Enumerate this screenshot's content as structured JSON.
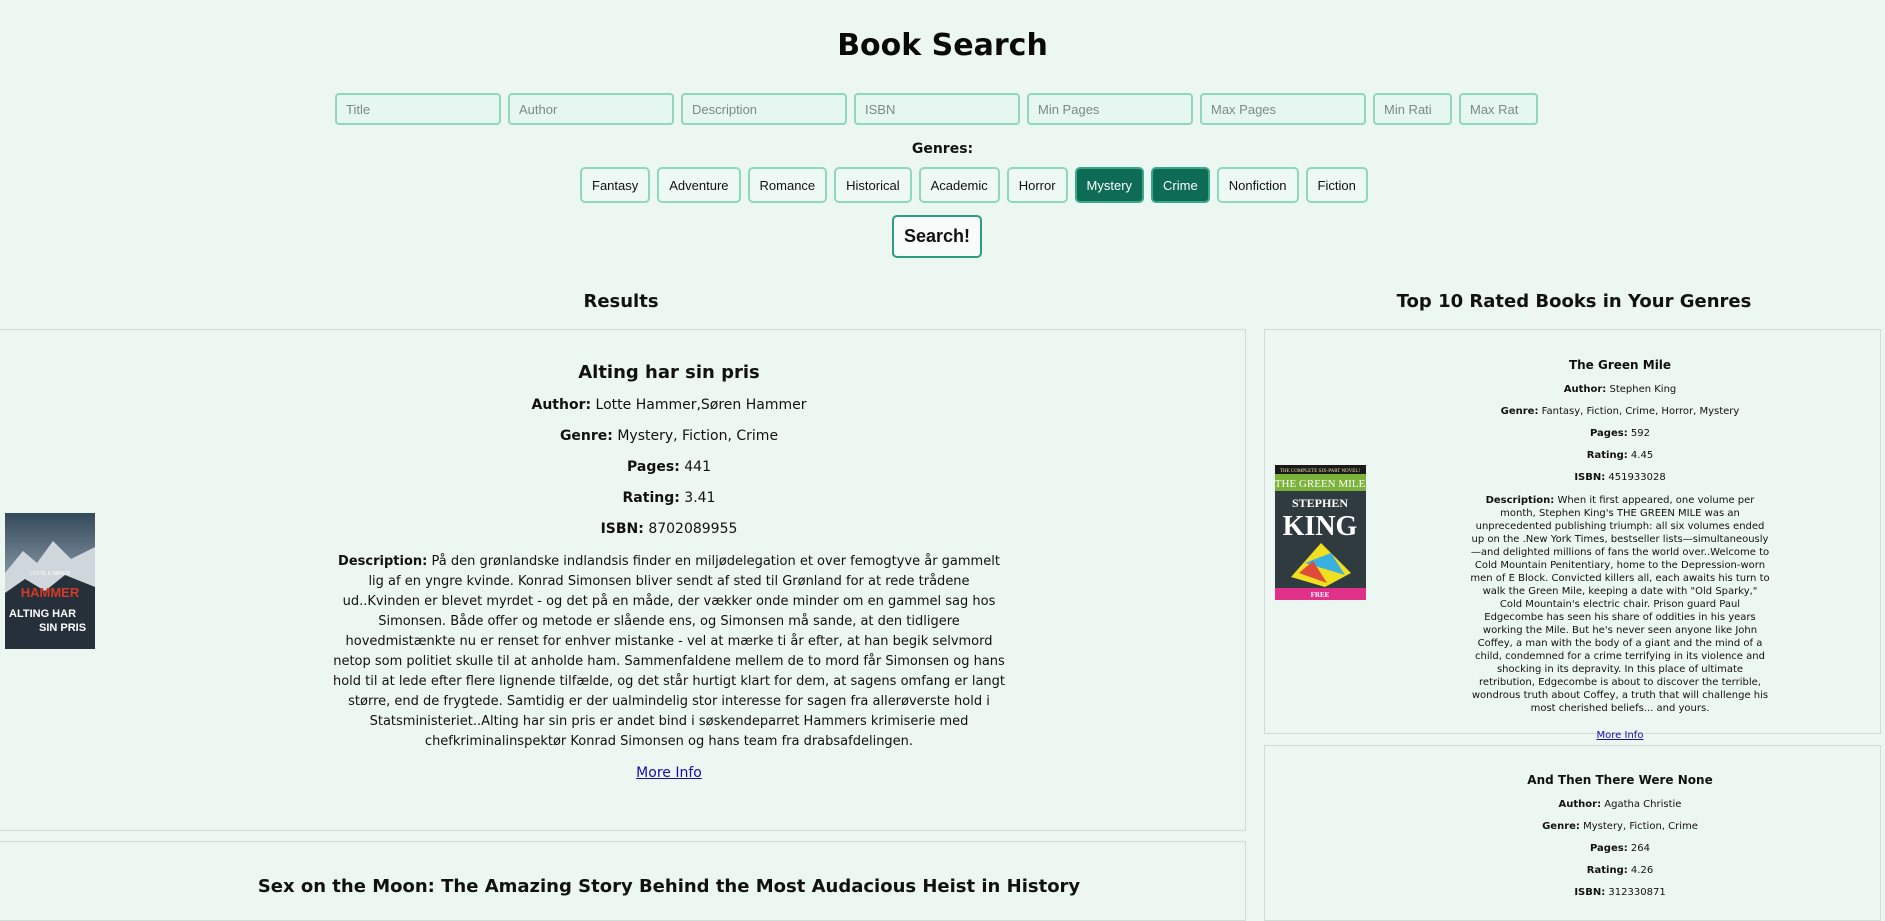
{
  "header": {
    "title": "Book Search"
  },
  "filters": [
    {
      "name": "title-input",
      "placeholder": "Title",
      "value": ""
    },
    {
      "name": "author-input",
      "placeholder": "Author",
      "value": ""
    },
    {
      "name": "description-input",
      "placeholder": "Description",
      "value": ""
    },
    {
      "name": "isbn-input",
      "placeholder": "ISBN",
      "value": ""
    },
    {
      "name": "min-pages-input",
      "placeholder": "Min Pages",
      "value": ""
    },
    {
      "name": "max-pages-input",
      "placeholder": "Max Pages",
      "value": ""
    },
    {
      "name": "min-rating-input",
      "placeholder": "Min Rati",
      "value": ""
    },
    {
      "name": "max-rating-input",
      "placeholder": "Max Rat",
      "value": ""
    }
  ],
  "genres": {
    "label": "Genres:",
    "items": [
      {
        "label": "Fantasy",
        "active": false
      },
      {
        "label": "Adventure",
        "active": false
      },
      {
        "label": "Romance",
        "active": false
      },
      {
        "label": "Historical",
        "active": false
      },
      {
        "label": "Academic",
        "active": false
      },
      {
        "label": "Horror",
        "active": false
      },
      {
        "label": "Mystery",
        "active": true
      },
      {
        "label": "Crime",
        "active": true
      },
      {
        "label": "Nonfiction",
        "active": false
      },
      {
        "label": "Fiction",
        "active": false
      }
    ]
  },
  "search_button": "Search!",
  "labels": {
    "author": "Author:",
    "genre": "Genre:",
    "pages": "Pages:",
    "rating": "Rating:",
    "isbn": "ISBN:",
    "description": "Description:",
    "more_info": "More Info"
  },
  "results": {
    "heading": "Results",
    "items": [
      {
        "title": "Alting har sin pris",
        "author": "Lotte Hammer,Søren Hammer",
        "genre": "Mystery, Fiction, Crime",
        "pages": "441",
        "rating": "3.41",
        "isbn": "8702089955",
        "description": "På den grønlandske indlandsis finder en miljødelegation et over femogtyve år gammelt lig af en yngre kvinde. Konrad Simonsen bliver sendt af sted til Grønland for at rede trådene ud..Kvinden er blevet myrdet - og det på en måde, der vækker onde minder om en gammel sag hos Simonsen. Både offer og metode er slående ens, og Simonsen må sande, at den tidligere hovedmistænkte nu er renset for enhver mistanke - vel at mærke ti år efter, at han begik selvmord netop som politiet skulle til at anholde ham. Sammenfaldene mellem de to mord får Simonsen og hans hold til at lede efter flere lignende tilfælde, og det står hurtigt klart for dem, at sagens omfang er langt større, end de frygtede. Samtidig er der ualmindelig stor interesse for sagen fra allerøverste hold i Statsministeriet..Alting har sin pris er andet bind i søskendeparret Hammers krimiserie med chefkriminalinspektør Konrad Simonsen og hans team fra drabsafdelingen.",
        "cover": {
          "top_text": "LOTTE & SØREN",
          "brand": "HAMMER",
          "line1": "ALTING HAR",
          "line2": "SIN PRIS"
        }
      },
      {
        "title": "Sex on the Moon: The Amazing Story Behind the Most Audacious Heist in History"
      }
    ]
  },
  "top_rated": {
    "heading": "Top 10 Rated Books in Your Genres",
    "items": [
      {
        "title": "The Green Mile",
        "author": "Stephen King",
        "genre": "Fantasy, Fiction, Crime, Horror, Mystery",
        "pages": "592",
        "rating": "4.45",
        "isbn": "451933028",
        "description": "When it first appeared, one volume per month, Stephen King's THE GREEN MILE was an unprecedented publishing triumph: all six volumes ended up on the .New York Times, bestseller lists—simultaneously—and delighted millions of fans the world over..Welcome to Cold Mountain Penitentiary, home to the Depression-worn men of E Block. Convicted killers all, each awaits his turn to walk the Green Mile, keeping a date with \"Old Sparky,\" Cold Mountain's electric chair. Prison guard Paul Edgecombe has seen his share of oddities in his years working the Mile. But he's never seen anyone like John Coffey, a man with the body of a giant and the mind of a child, condemned for a crime terrifying in its violence and shocking in its depravity. In this place of ultimate retribution, Edgecombe is about to discover the terrible, wondrous truth about Coffey, a truth that will challenge his most cherished beliefs... and yours.",
        "cover": {
          "top_text": "THE COMPLETE SIX-PART NOVEL!",
          "series": "THE GREEN MILE",
          "author1": "STEPHEN",
          "author2": "KING",
          "bottom": "FREE"
        }
      },
      {
        "title": "And Then There Were None",
        "author": "Agatha Christie",
        "genre": "Mystery, Fiction, Crime",
        "pages": "264",
        "rating": "4.26",
        "isbn": "312330871"
      }
    ]
  },
  "colors": {
    "background": "#edf7f2",
    "accent": "#0e6b56",
    "border": "#8fd8c0"
  }
}
